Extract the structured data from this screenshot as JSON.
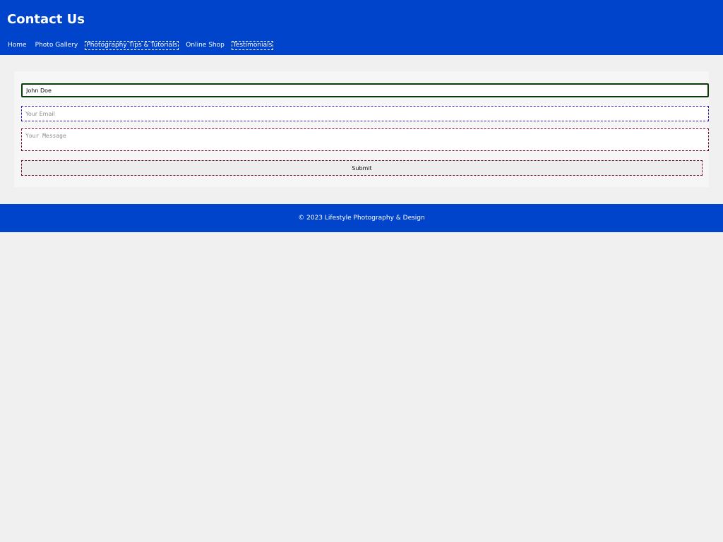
{
  "header": {
    "title": "Contact Us",
    "nav": [
      {
        "label": "Home"
      },
      {
        "label": "Photo Gallery"
      },
      {
        "label": "Photography Tips & Tutorials"
      },
      {
        "label": "Online Shop"
      },
      {
        "label": "Testimonials"
      }
    ]
  },
  "form": {
    "name_value": "John Doe",
    "email_placeholder": "Your Email",
    "message_placeholder": "Your Message",
    "submit_label": "Submit"
  },
  "footer": {
    "text": "© 2023 Lifestyle Photography & Design"
  },
  "colors": {
    "brand": "#0044cc",
    "page_background": "#f0f0f0"
  }
}
